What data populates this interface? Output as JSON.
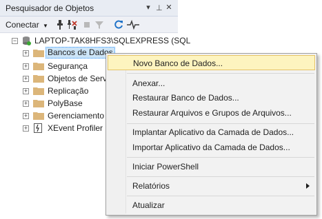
{
  "panel": {
    "title": "Pesquisador de Objetos",
    "controls": {
      "dropdown": "▾",
      "pin": "⊣",
      "close": "✕"
    }
  },
  "toolbar": {
    "connect_label": "Conectar",
    "icons": [
      "connect-icon",
      "disconnect-icon",
      "stop-icon",
      "filter-icon",
      "refresh-icon",
      "activity-monitor-icon"
    ]
  },
  "tree": {
    "server": "LAPTOP-TAK8HFS3\\SQLEXPRESS (SQL",
    "nodes": [
      {
        "label": "Bancos de Dados",
        "icon": "folder-icon",
        "selected": true
      },
      {
        "label": "Segurança",
        "icon": "folder-icon"
      },
      {
        "label": "Objetos de Servi",
        "icon": "folder-icon"
      },
      {
        "label": "Replicação",
        "icon": "folder-icon"
      },
      {
        "label": "PolyBase",
        "icon": "folder-icon"
      },
      {
        "label": "Gerenciamento",
        "icon": "folder-icon"
      },
      {
        "label": "XEvent Profiler",
        "icon": "xevent-profiler-icon"
      }
    ]
  },
  "context_menu": {
    "items": [
      {
        "label": "Novo Banco de Dados...",
        "highlighted": true
      },
      {
        "label": "Anexar..."
      },
      {
        "label": "Restaurar Banco de Dados..."
      },
      {
        "label": "Restaurar Arquivos e Grupos de Arquivos..."
      },
      {
        "label": "Implantar Aplicativo da Camada de Dados..."
      },
      {
        "label": "Importar Aplicativo da Camada de Dados..."
      },
      {
        "label": "Iniciar PowerShell"
      },
      {
        "label": "Relatórios",
        "submenu": true
      },
      {
        "label": "Atualizar"
      }
    ]
  },
  "colors": {
    "selection": "#cce4f7",
    "menu_highlight": "#fdf4bf",
    "folder": "#dcb67a",
    "refresh": "#1e72c8"
  }
}
